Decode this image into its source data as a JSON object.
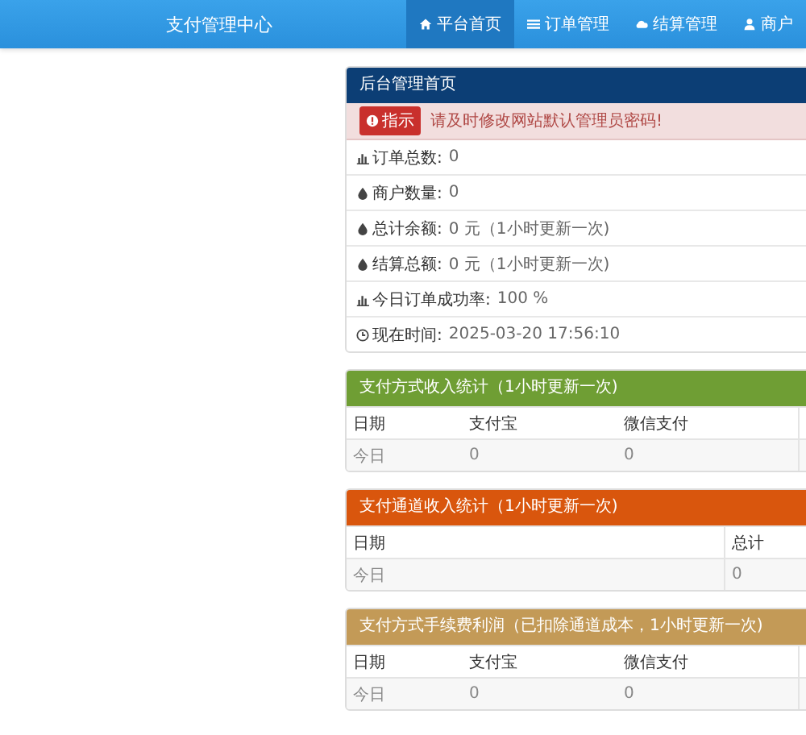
{
  "navbar": {
    "brand": "支付管理中心",
    "items": [
      {
        "label": "平台首页",
        "kind": "home",
        "selected": true
      },
      {
        "label": "订单管理",
        "kind": "list",
        "selected": false
      },
      {
        "label": "结算管理",
        "kind": "cloud",
        "selected": false
      },
      {
        "label": "商户",
        "kind": "user",
        "selected": false
      }
    ]
  },
  "overview": {
    "title": "后台管理首页",
    "alert": {
      "badge": "指示",
      "text": "请及时修改网站默认管理员密码!"
    },
    "rows": [
      {
        "kind": "chart",
        "label": "订单总数:",
        "value": "0"
      },
      {
        "kind": "drop",
        "label": "商户数量:",
        "value": "0"
      },
      {
        "kind": "drop",
        "label": "总计余额:",
        "value": "0 元（1小时更新一次)"
      },
      {
        "kind": "drop",
        "label": "结算总额:",
        "value": "0 元（1小时更新一次)"
      },
      {
        "kind": "chart",
        "label": "今日订单成功率:",
        "value": "100 %"
      },
      {
        "kind": "clock",
        "label": "现在时间:",
        "value": "2025-03-20 17:56:10"
      }
    ]
  },
  "tables": [
    {
      "title": "支付方式收入统计（1小时更新一次)",
      "color": "#6f9e34",
      "kind": "methods",
      "columns": [
        "日期",
        "支付宝",
        "微信支付"
      ],
      "rows": [
        [
          "今日",
          "0",
          "0"
        ]
      ]
    },
    {
      "title": "支付通道收入统计（1小时更新一次)",
      "color": "#d9560d",
      "kind": "channels",
      "columns": [
        "日期",
        "总计"
      ],
      "rows": [
        [
          "今日",
          "0"
        ]
      ]
    },
    {
      "title": "支付方式手续费利润（已扣除通道成本，1小时更新一次)",
      "color": "#c39a57",
      "kind": "methods",
      "columns": [
        "日期",
        "支付宝",
        "微信支付"
      ],
      "rows": [
        [
          "今日",
          "0",
          "0"
        ]
      ]
    }
  ]
}
